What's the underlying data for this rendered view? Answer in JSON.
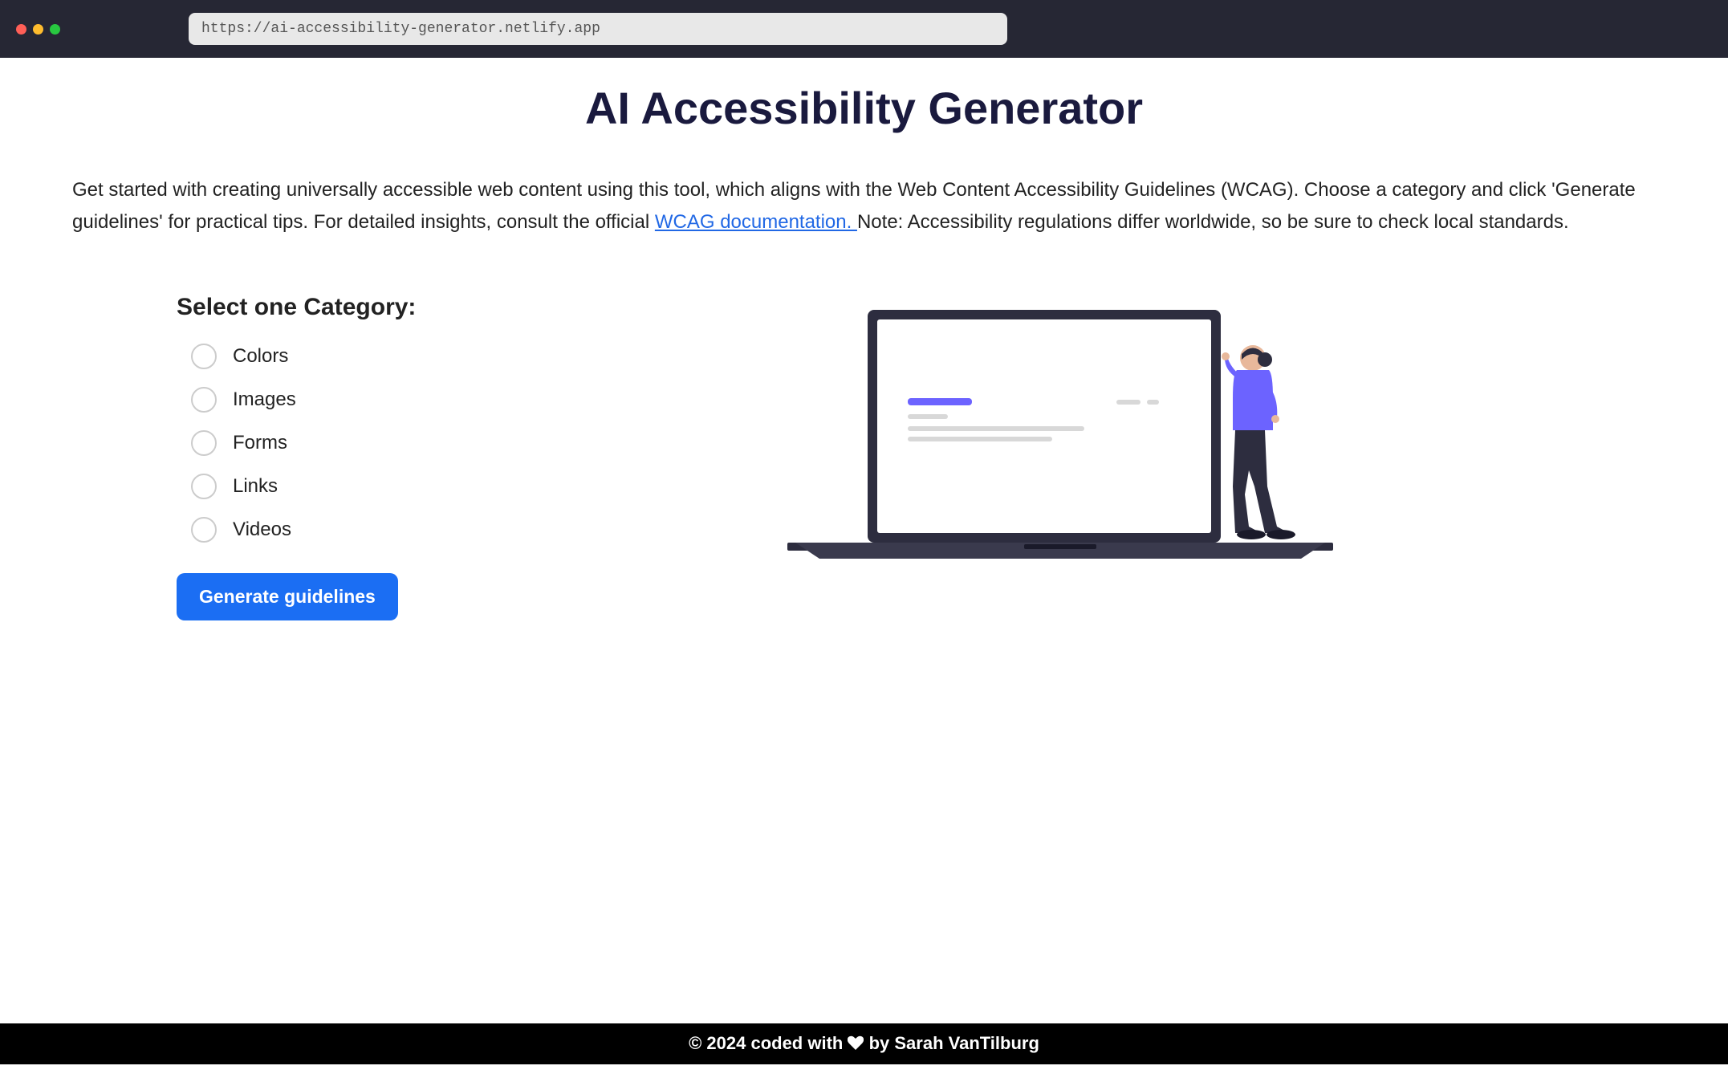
{
  "browser": {
    "url": "https://ai-accessibility-generator.netlify.app"
  },
  "page": {
    "title": "AI Accessibility Generator",
    "intro_before": "Get started with creating universally accessible web content using this tool, which aligns with the Web Content Accessibility Guidelines (WCAG). Choose a category and click 'Generate guidelines' for practical tips. For detailed insights, consult the official ",
    "intro_link": "WCAG documentation. ",
    "intro_after": " Note: Accessibility regulations differ worldwide, so be sure to check local standards."
  },
  "form": {
    "heading": "Select one Category:",
    "options": {
      "colors": "Colors",
      "images": "Images",
      "forms": "Forms",
      "links": "Links",
      "videos": "Videos"
    },
    "button_label": "Generate guidelines"
  },
  "footer": {
    "prefix": "© 2024 coded with ",
    "suffix": " by Sarah VanTilburg"
  }
}
